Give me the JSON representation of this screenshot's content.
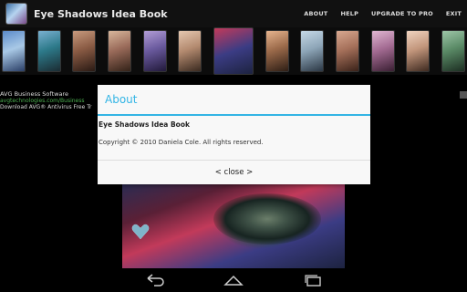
{
  "app": {
    "title": "Eye Shadows Idea Book"
  },
  "menu": {
    "about": "ABOUT",
    "help": "HELP",
    "upgrade": "UPGRADE TO PRO",
    "exit": "EXIT"
  },
  "ad": {
    "title": "AVG Business Software",
    "url": "avgtechnologies.com/Business",
    "desc": "Download AVG® Antivirus Free Tr"
  },
  "dialog": {
    "title": "About",
    "app_name": "Eye Shadows Idea Book",
    "copyright": "Copyright © 2010 Daniela Cole. All rights reserved.",
    "close_label": "< close >"
  },
  "colors": {
    "accent": "#33b5e5",
    "ad_link": "#4caf50"
  },
  "icons": {
    "back": "back-icon",
    "home": "home-icon",
    "recents": "recent-apps-icon"
  }
}
